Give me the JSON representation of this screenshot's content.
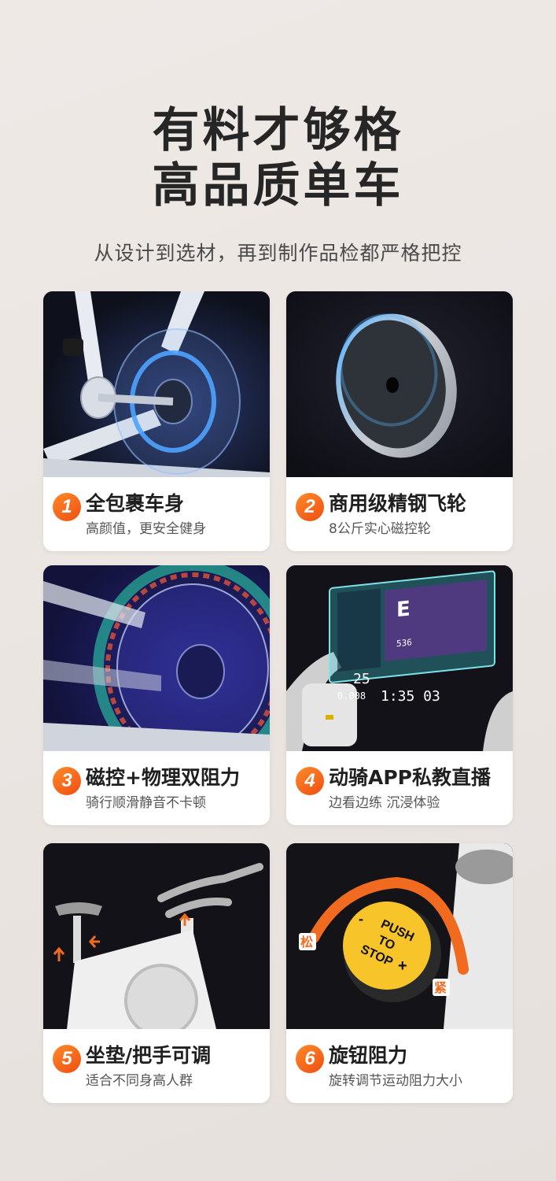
{
  "header": {
    "title_line1": "有料才够格",
    "title_line2": "高品质单车",
    "subtitle": "从设计到选材，再到制作品检都严格把控"
  },
  "features": [
    {
      "num": "1",
      "title": "全包裹车身",
      "desc": "高颜值，更安全健身"
    },
    {
      "num": "2",
      "title": "商用级精钢飞轮",
      "desc": "8公斤实心磁控轮"
    },
    {
      "num": "3",
      "title": "磁控+物理双阻力",
      "desc": "骑行顺滑静音不卡顿"
    },
    {
      "num": "4",
      "title": "动骑APP私教直播",
      "desc": "边看边练 沉浸体验"
    },
    {
      "num": "5",
      "title": "坐垫/把手可调",
      "desc": "适合不同身高人群"
    },
    {
      "num": "6",
      "title": "旋钮阻力",
      "desc": "旋转调节运动阻力大小"
    }
  ],
  "monitor": {
    "speed": "25",
    "distance": "0.008",
    "time": "1:35 03",
    "calories": "536"
  },
  "knob": {
    "line1": "PUSH",
    "line2": "TO",
    "line3": "STOP",
    "plus": "+",
    "minus": "-",
    "loose": "松",
    "tight": "紧"
  },
  "colors": {
    "accent": "#f06a1f",
    "background": "#ece6e3",
    "card": "#ffffff",
    "image_bg": "#14141b",
    "knob_yellow": "#f7c42a"
  }
}
